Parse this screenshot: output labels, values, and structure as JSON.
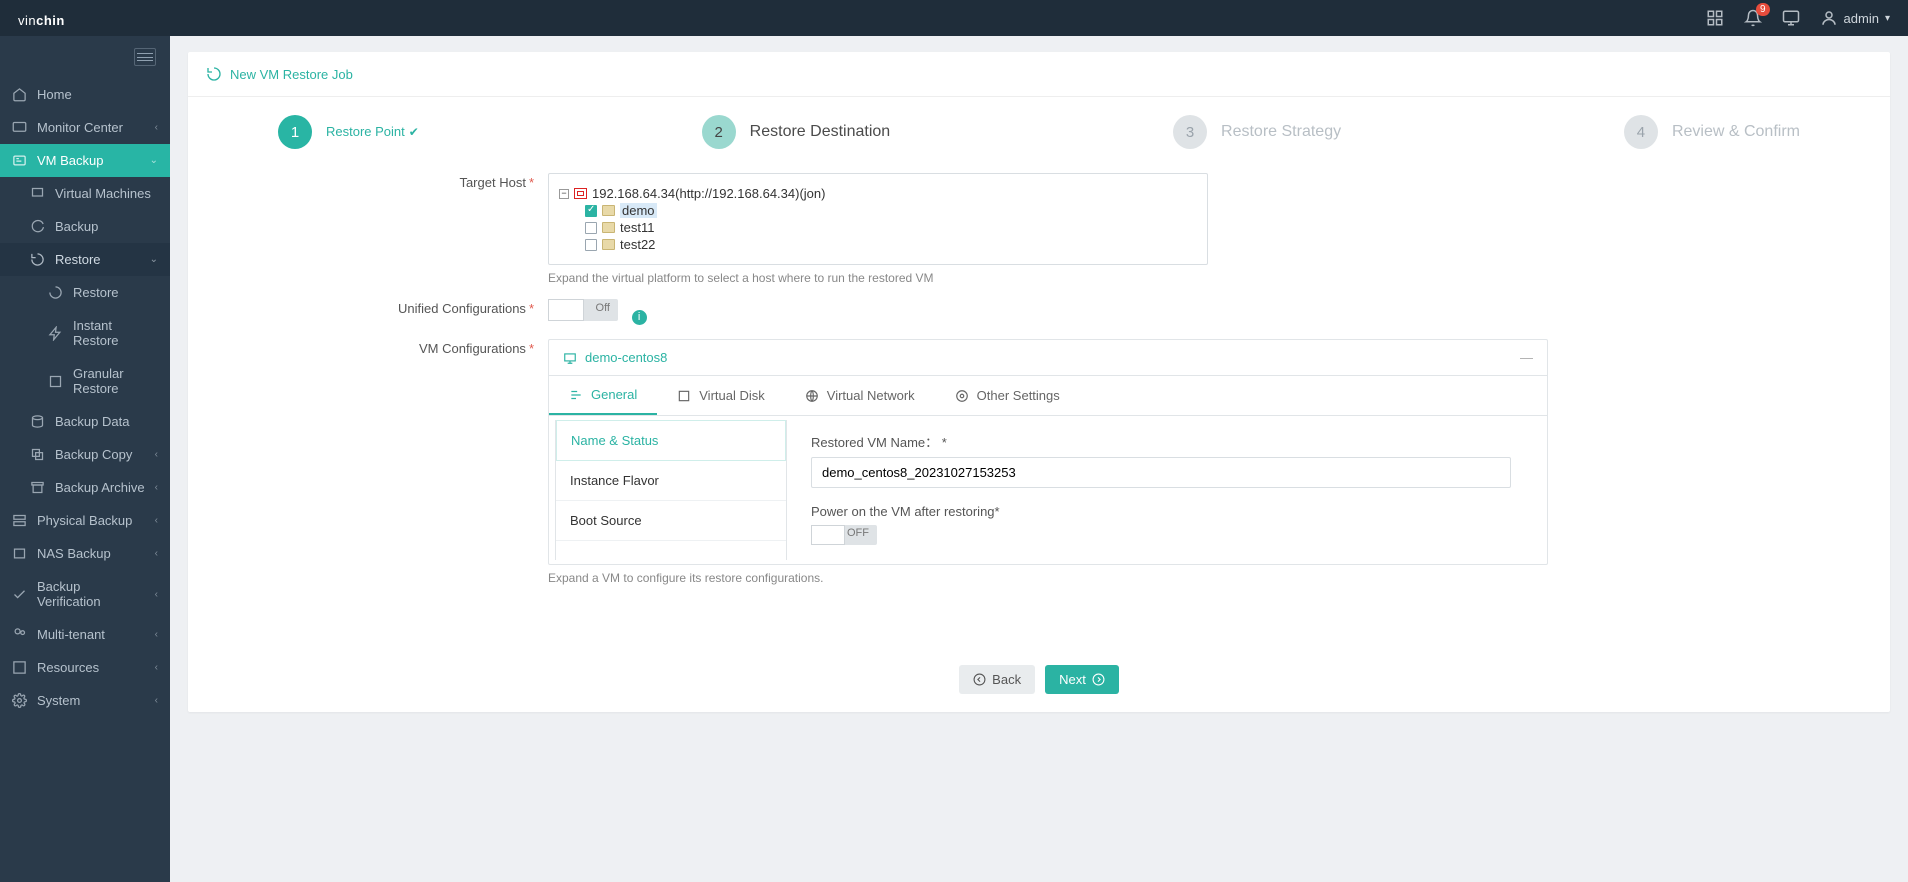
{
  "brand": {
    "part1": "vin",
    "part2": "chin"
  },
  "topbar": {
    "badge": "9",
    "user": "admin"
  },
  "sidebar": {
    "home": "Home",
    "monitor": "Monitor Center",
    "vmbackup": "VM Backup",
    "vmachines": "Virtual Machines",
    "backup": "Backup",
    "restore": "Restore",
    "restore2": "Restore",
    "instant": "Instant Restore",
    "granular": "Granular Restore",
    "bdata": "Backup Data",
    "bcopy": "Backup Copy",
    "barchive": "Backup Archive",
    "physical": "Physical Backup",
    "nas": "NAS Backup",
    "verif": "Backup Verification",
    "mtenant": "Multi-tenant",
    "resources": "Resources",
    "system": "System"
  },
  "page": {
    "title": "New VM Restore Job"
  },
  "steps": {
    "s1": {
      "num": "1",
      "label": "Restore Point"
    },
    "s2": {
      "num": "2",
      "label": "Restore Destination"
    },
    "s3": {
      "num": "3",
      "label": "Restore Strategy"
    },
    "s4": {
      "num": "4",
      "label": "Review & Confirm"
    }
  },
  "labels": {
    "target_host": "Target Host",
    "unified": "Unified Configurations",
    "vmconf": "VM Configurations",
    "tree_hint": "Expand the virtual platform to select a host where to run the restored VM",
    "vmconf_hint": "Expand a VM to configure its restore configurations."
  },
  "tree": {
    "root": "192.168.64.34(http://192.168.64.34)(jon)",
    "n1": "demo",
    "n2": "test11",
    "n3": "test22"
  },
  "toggle": {
    "off": "Off",
    "OFF": "OFF"
  },
  "vm": {
    "name": "demo-centos8",
    "tabs": {
      "general": "General",
      "vdisk": "Virtual Disk",
      "vnet": "Virtual Network",
      "other": "Other Settings"
    },
    "sub": {
      "ns": "Name & Status",
      "flavor": "Instance Flavor",
      "boot": "Boot Source"
    },
    "form": {
      "rname_label": "Restored VM Name：",
      "rname_value": "demo_centos8_20231027153253",
      "power_label": "Power on the VM after restoring"
    }
  },
  "buttons": {
    "back": "Back",
    "next": "Next"
  }
}
